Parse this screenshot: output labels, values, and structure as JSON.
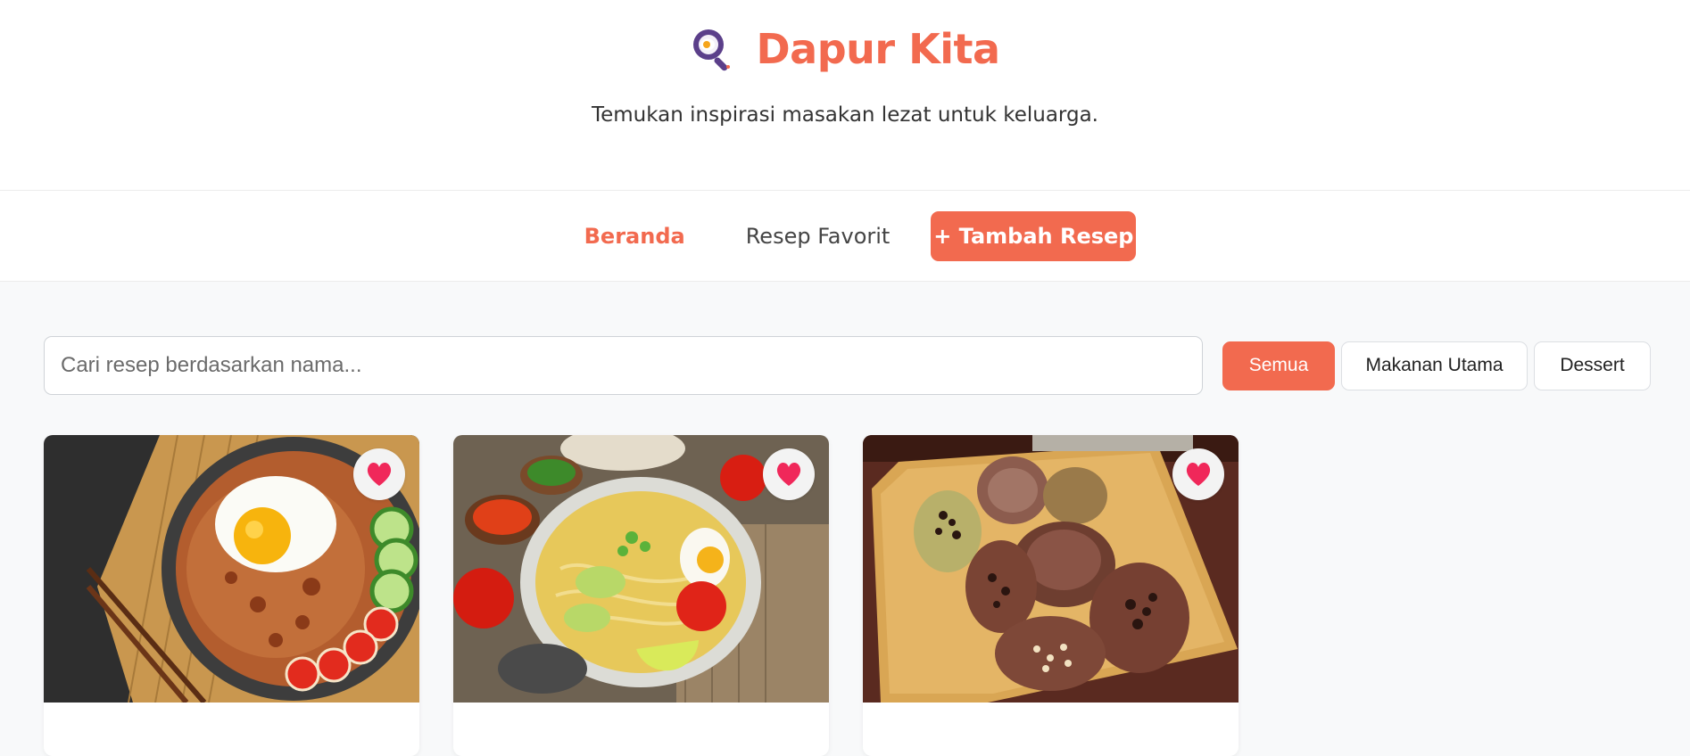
{
  "app": {
    "title": "Dapur Kita",
    "tagline": "Temukan inspirasi masakan lezat untuk keluarga.",
    "logo_icon": "frying-pan-egg-icon",
    "accent_color": "#f26a4f"
  },
  "nav": {
    "home_label": "Beranda",
    "favorites_label": "Resep Favorit",
    "add_label": "+ Tambah Resep"
  },
  "search": {
    "placeholder": "Cari resep berdasarkan nama...",
    "value": ""
  },
  "filters": {
    "selected": "Semua",
    "options": [
      "Semua",
      "Makanan Utama",
      "Dessert"
    ]
  },
  "recipes": [
    {
      "image": "nasi-goreng-photo",
      "favorite_icon": "heart-icon"
    },
    {
      "image": "soto-ayam-photo",
      "favorite_icon": "heart-icon"
    },
    {
      "image": "kue-cubit-photo",
      "favorite_icon": "heart-icon"
    }
  ]
}
